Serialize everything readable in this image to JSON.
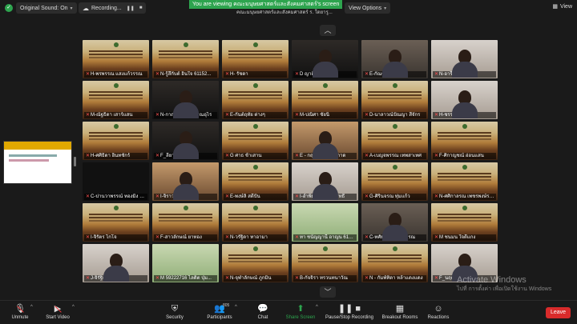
{
  "topbar": {
    "original_sound": "Original Sound: On",
    "recording": "Recording...",
    "viewing_banner": "You are viewing คณะมนุษยศาสตร์และสังคมศาสตร์'s screen",
    "viewing_sub": "คณะมนุษยศาสตร์และสังคมศาสตร์ ร. ใดยารู...",
    "view_options": "View Options",
    "view": "View"
  },
  "participants": [
    {
      "name": "H-พรพรรณ แสงแก้วรรณ",
      "type": "slide"
    },
    {
      "name": "N-รู้สึกับด์ อินใจ 61152...",
      "type": "slide"
    },
    {
      "name": "H- รัชดา",
      "type": "slide"
    },
    {
      "name": "D ญาติ กรอมยุติ",
      "type": "cam dark"
    },
    {
      "name": "E-กัณฑ์ฐ ชุมภูแก้ว",
      "type": "cam"
    },
    {
      "name": "N-อารีริยา ทราศา",
      "type": "cam light"
    },
    {
      "name": "M-ณัฐธิดา เสาร์แสน",
      "type": "slide"
    },
    {
      "name": "N-กาญจน์ฤดี สุวรรณอุไร",
      "type": "cam dark"
    },
    {
      "name": "E-กันต์ฤทัย ต่างๆ",
      "type": "slide"
    },
    {
      "name": "M-ปณิศา ชัยนิ",
      "type": "slide"
    },
    {
      "name": "D-นาลาวณ์ปัณญา สีจักร",
      "type": "slide"
    },
    {
      "name": "H-ชรรามิ บุญหล้า",
      "type": "cam light"
    },
    {
      "name": "H-ศศิธิดา อินทชักร์",
      "type": "slide"
    },
    {
      "name": "F_ลี้ยา หุ้ม ต้นสงัก",
      "type": "cam dark"
    },
    {
      "name": "G ศาธ ช้าเสาน",
      "type": "slide"
    },
    {
      "name": "E - กฤษฐาพิกา สิ่งกาด",
      "type": "cam warm"
    },
    {
      "name": "A-เบญจพรรณ เทพสาเทศ",
      "type": "slide"
    },
    {
      "name": "F-ศิกาญชณ์ อ่อนแสน",
      "type": "slide"
    },
    {
      "name": "C-ปานวาพรรณ์ ทองมิ้ง 611...",
      "type": "black"
    },
    {
      "name": "I-จิราวะ สตาเกง",
      "type": "cam warm"
    },
    {
      "name": "E-พงษ์ลิ สดีปัน",
      "type": "slide"
    },
    {
      "name": "I-อำพิมพ์ แสงทุ่งวิสิทธิ์",
      "type": "cam light"
    },
    {
      "name": "G-ศิรินจรณ ทุ่มแก้ว",
      "type": "slide"
    },
    {
      "name": "N-ศศิกาลรณ เพชรพงษ์รอ...",
      "type": "slide"
    },
    {
      "name": "I-จิรัตร ไกโจ",
      "type": "slide"
    },
    {
      "name": "F-สาวลักษณ์ ยาทอง",
      "type": "slide"
    },
    {
      "name": "N-วรัฐิดา ทาอามา",
      "type": "slide"
    },
    {
      "name": "ทา ชนัญญานี อาญน 6115211...",
      "type": "green"
    },
    {
      "name": "C-ทศัยภัทร ท้าวพรรณ",
      "type": "cam"
    },
    {
      "name": "M ชนมน ใจดีแกง",
      "type": "slide"
    },
    {
      "name": "J-จิรัฐิติกา จักชล",
      "type": "cam light"
    },
    {
      "name": "M 59222716 ไลติต ปุ่ม...",
      "type": "green"
    },
    {
      "name": "N-จุฬาลักษณ์ ภูกมิ่น",
      "type": "slide"
    },
    {
      "name": "B-กัจจิรา ทรวนทนาวัณ",
      "type": "slide"
    },
    {
      "name": "N - กัมพ์ทิดา หล้าแดงแดง",
      "type": "slide"
    },
    {
      "name": "F_นฤกมย ศิกุโส...",
      "type": "cam light"
    }
  ],
  "extra_tiles": [
    {
      "name": "H-กัณฑ์มาสิ จันทาศศิวร",
      "type": "cam"
    },
    {
      "name": "E-กันตพร ขันธ์ขะม",
      "type": "cam"
    },
    {
      "name": "N-พิทาพร ฉลวานต",
      "type": "slide"
    },
    {
      "name": "N-พลิศาลลิ อินเสิงหม",
      "type": "slide"
    },
    {
      "name": "I-สาวาร์นิตย์ แสงพันหนา",
      "type": "slide"
    },
    {
      "name": "I-กัณฑ์ร์ต อินทา 61152...",
      "type": "slide"
    }
  ],
  "watermark": {
    "line1": "Activate Windows",
    "line2": "ไปที่ การตั้งค่า เพื่อเปิดใช้งาน Windows"
  },
  "toolbar": {
    "unmute": "Unmute",
    "start_video": "Start Video",
    "security": "Security",
    "participants": "Participants",
    "participants_count": "805",
    "chat": "Chat",
    "share_screen": "Share Screen",
    "pause_recording": "Pause/Stop Recording",
    "breakout": "Breakout Rooms",
    "reactions": "Reactions",
    "leave": "Leave"
  }
}
